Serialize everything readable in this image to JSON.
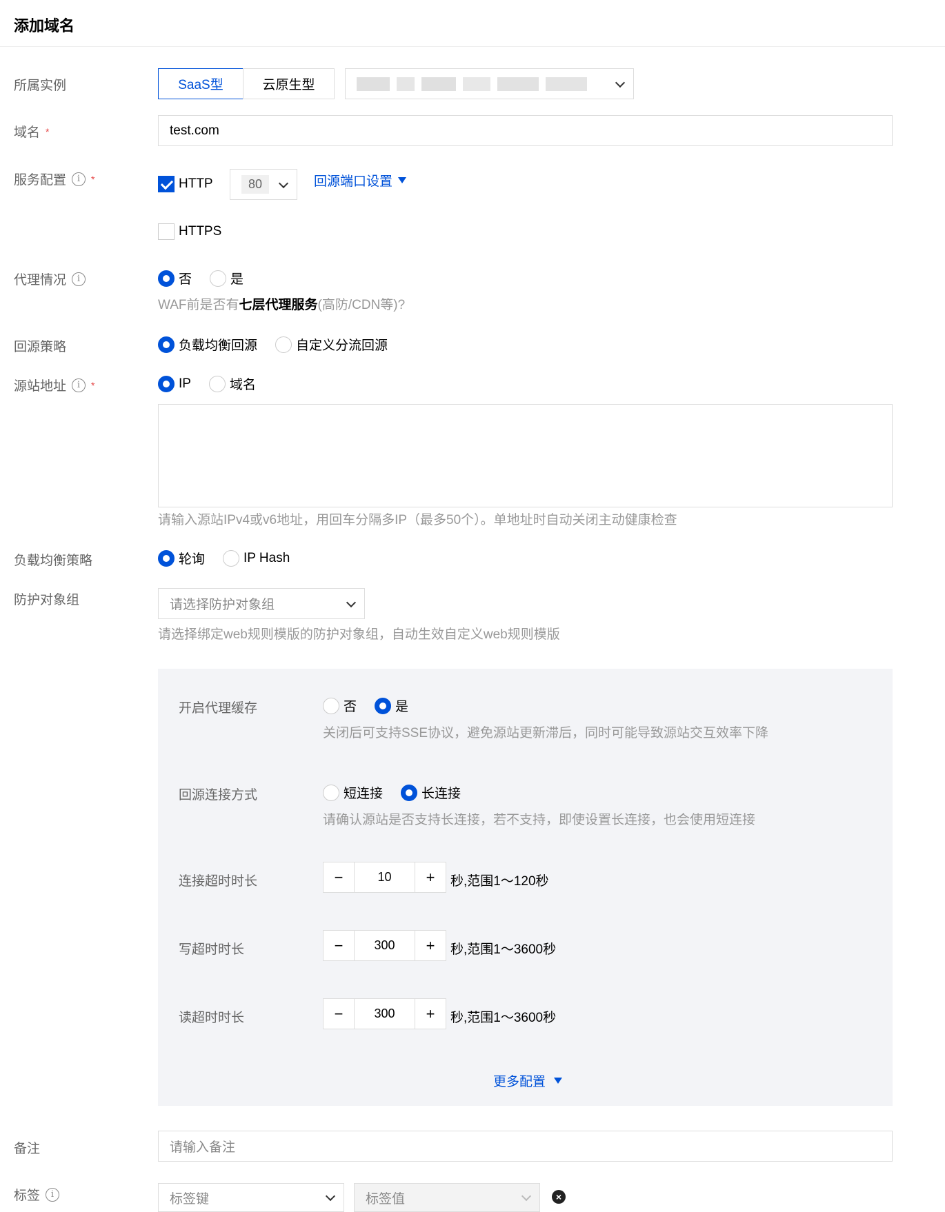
{
  "header": {
    "title": "添加域名"
  },
  "instance": {
    "label": "所属实例",
    "types": [
      "SaaS型",
      "云原生型"
    ],
    "selected_type": "SaaS型"
  },
  "domain": {
    "label": "域名",
    "value": "test.com"
  },
  "service": {
    "label": "服务配置",
    "http_label": "HTTP",
    "http_checked": true,
    "http_port": "80",
    "https_label": "HTTPS",
    "https_checked": false,
    "port_settings_link": "回源端口设置"
  },
  "proxy": {
    "label": "代理情况",
    "options": [
      "否",
      "是"
    ],
    "selected": "否",
    "hint_prefix": "WAF前是否有",
    "hint_bold": "七层代理服务",
    "hint_suffix": "(高防/CDN等)?"
  },
  "origin_strategy": {
    "label": "回源策略",
    "options": [
      "负载均衡回源",
      "自定义分流回源"
    ],
    "selected": "负载均衡回源"
  },
  "origin_address": {
    "label": "源站地址",
    "options": [
      "IP",
      "域名"
    ],
    "selected": "IP",
    "hint": "请输入源站IPv4或v6地址，用回车分隔多IP（最多50个）。单地址时自动关闭主动健康检查"
  },
  "lb_strategy": {
    "label": "负载均衡策略",
    "options": [
      "轮询",
      "IP Hash"
    ],
    "selected": "轮询"
  },
  "protect_group": {
    "label": "防护对象组",
    "placeholder": "请选择防护对象组",
    "hint": "请选择绑定web规则模版的防护对象组，自动生效自定义web规则模版"
  },
  "advanced": {
    "cache": {
      "label": "开启代理缓存",
      "options": [
        "否",
        "是"
      ],
      "selected": "是",
      "hint": "关闭后可支持SSE协议，避免源站更新滞后，同时可能导致源站交互效率下降"
    },
    "connection": {
      "label": "回源连接方式",
      "options": [
        "短连接",
        "长连接"
      ],
      "selected": "长连接",
      "hint": "请确认源站是否支持长连接，若不支持，即使设置长连接，也会使用短连接"
    },
    "connect_timeout": {
      "label": "连接超时时长",
      "value": "10",
      "unit": "秒,范围1～120秒"
    },
    "write_timeout": {
      "label": "写超时时长",
      "value": "300",
      "unit": "秒,范围1～3600秒"
    },
    "read_timeout": {
      "label": "读超时时长",
      "value": "300",
      "unit": "秒,范围1～3600秒"
    },
    "more_link": "更多配置"
  },
  "remark": {
    "label": "备注",
    "placeholder": "请输入备注"
  },
  "tags": {
    "label": "标签",
    "key_placeholder": "标签键",
    "value_placeholder": "标签值"
  },
  "colors": {
    "primary": "#0052d9",
    "required": "#e54545",
    "panel_bg": "#f3f4f7"
  }
}
